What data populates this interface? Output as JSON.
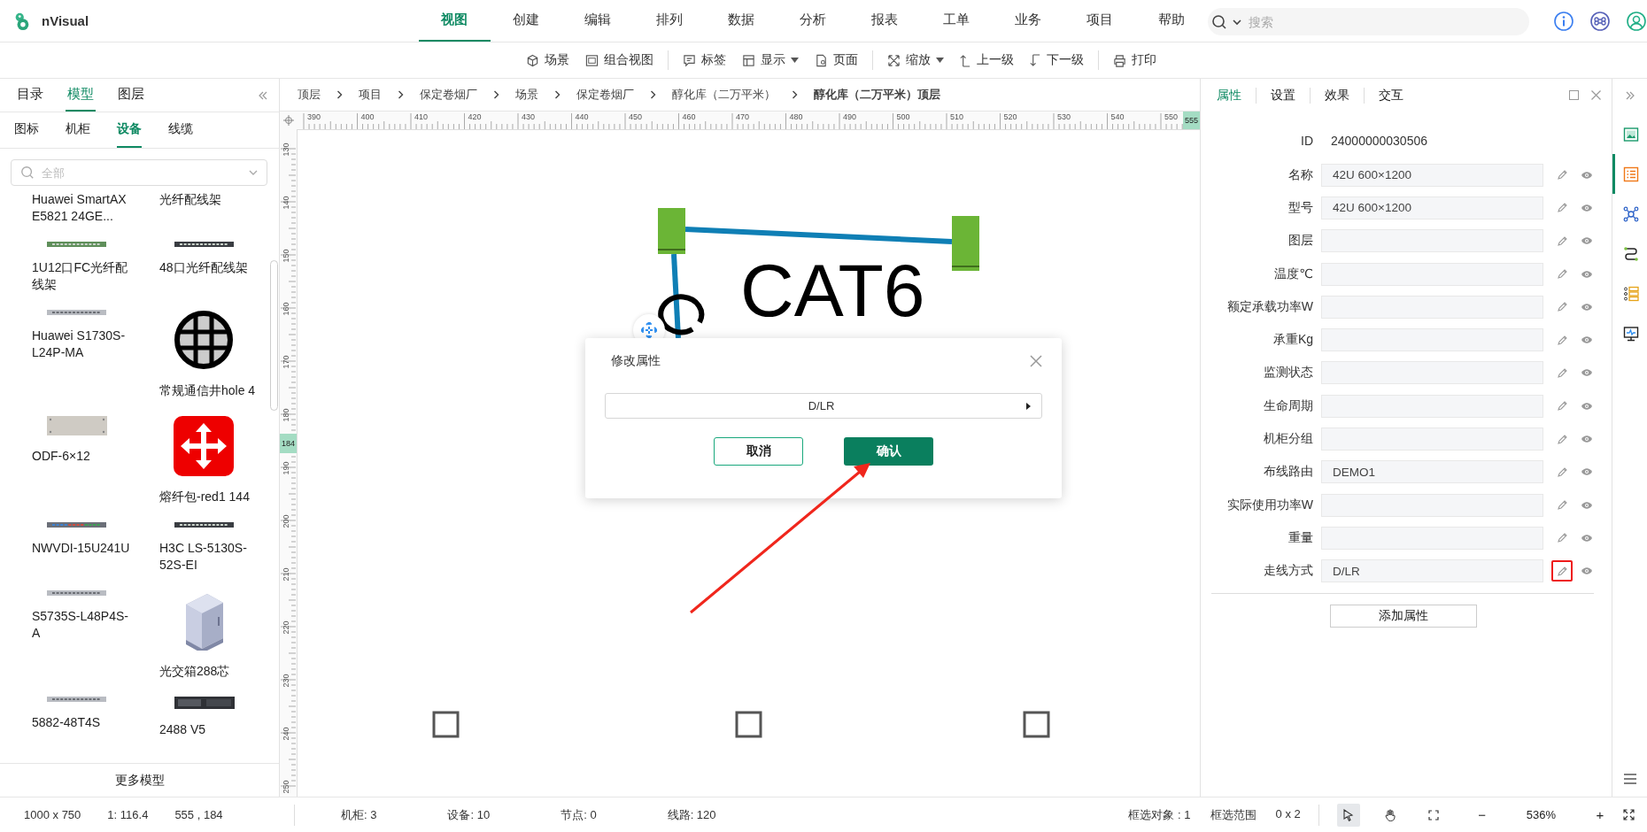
{
  "app": {
    "name": "nVisual"
  },
  "menu": [
    {
      "label": "视图",
      "selected": true
    },
    {
      "label": "创建",
      "selected": false
    },
    {
      "label": "编辑",
      "selected": false
    },
    {
      "label": "排列",
      "selected": false
    },
    {
      "label": "数据",
      "selected": false
    },
    {
      "label": "分析",
      "selected": false
    },
    {
      "label": "报表",
      "selected": false
    },
    {
      "label": "工单",
      "selected": false
    },
    {
      "label": "业务",
      "selected": false
    },
    {
      "label": "项目",
      "selected": false
    },
    {
      "label": "帮助",
      "selected": false
    }
  ],
  "search": {
    "placeholder": "搜索"
  },
  "toolbar": [
    {
      "kind": "scene",
      "label": "场景",
      "dropdown": false
    },
    {
      "kind": "combined",
      "label": "组合视图",
      "dropdown": false
    },
    {
      "kind": "divider"
    },
    {
      "kind": "label",
      "label": "标签",
      "dropdown": false
    },
    {
      "kind": "display",
      "label": "显示",
      "dropdown": true
    },
    {
      "kind": "page",
      "label": "页面",
      "dropdown": false
    },
    {
      "kind": "divider"
    },
    {
      "kind": "zoom",
      "label": "缩放",
      "dropdown": true
    },
    {
      "kind": "up",
      "label": "上一级",
      "dropdown": false
    },
    {
      "kind": "down",
      "label": "下一级",
      "dropdown": false
    },
    {
      "kind": "divider"
    },
    {
      "kind": "print",
      "label": "打印",
      "dropdown": false
    }
  ],
  "left_panel": {
    "tabs": [
      {
        "label": "目录",
        "selected": false
      },
      {
        "label": "模型",
        "selected": true
      },
      {
        "label": "图层",
        "selected": false
      }
    ],
    "subtabs": [
      {
        "label": "图标",
        "selected": false
      },
      {
        "label": "机柜",
        "selected": false
      },
      {
        "label": "设备",
        "selected": true
      },
      {
        "label": "线缆",
        "selected": false
      }
    ],
    "search": {
      "placeholder": "全部"
    },
    "items": [
      {
        "name": "Huawei SmartAX E5821 24GE..."
      },
      {
        "name": "光纤配线架"
      },
      {
        "name": "1U12口FC光纤配线架",
        "kind": "patch"
      },
      {
        "name": "48口光纤配线架",
        "kind": "dark"
      },
      {
        "name": "Huawei S1730S-L24P-MA",
        "kind": "switch"
      },
      {
        "name": "常规通信井hole 4",
        "kind": "manhole"
      },
      {
        "name": "ODF-6×12",
        "kind": "odf"
      },
      {
        "name": "熔纤包-red1 144",
        "kind": "splice"
      },
      {
        "name": "NWVDI-15U241U",
        "kind": "ports"
      },
      {
        "name": "H3C LS-5130S-52S-EI",
        "kind": "dark"
      },
      {
        "name": "S5735S-L48P4S-A",
        "kind": "switch"
      },
      {
        "name": "光交箱288芯",
        "kind": "cabinet"
      },
      {
        "name": "5882-48T4S",
        "kind": "switch"
      },
      {
        "name": "2488 V5",
        "kind": "server"
      }
    ],
    "more_button": "更多模型"
  },
  "breadcrumb": [
    "顶层",
    "项目",
    "保定卷烟厂",
    "场景",
    "保定卷烟厂",
    "醇化库（二万平米）",
    "醇化库（二万平米）顶层"
  ],
  "canvas": {
    "top_ruler": {
      "labels": [
        "390",
        "400",
        "410",
        "420",
        "430",
        "440",
        "450",
        "460",
        "470",
        "480",
        "490",
        "500",
        "510",
        "520",
        "530",
        "540",
        "550"
      ],
      "marker": "555"
    },
    "left_ruler": {
      "labels": [
        "130",
        "140",
        "150",
        "160",
        "170",
        "180",
        "190",
        "200",
        "210",
        "220",
        "230",
        "240",
        "250"
      ],
      "marker": "184"
    },
    "label": "CAT6"
  },
  "dialog": {
    "title": "修改属性",
    "select": {
      "value": "D/LR"
    },
    "buttons": [
      {
        "label": "取消",
        "kind": "secondary"
      },
      {
        "label": "确认",
        "kind": "primary"
      }
    ]
  },
  "properties": {
    "tabs": [
      {
        "label": "属性",
        "selected": true
      },
      {
        "label": "设置",
        "selected": false
      },
      {
        "label": "效果",
        "selected": false
      },
      {
        "label": "交互",
        "selected": false
      }
    ],
    "id": {
      "label": "ID",
      "value": "24000000030506"
    },
    "rows": [
      {
        "label": "名称",
        "value": "42U 600×1200",
        "highlighted": false
      },
      {
        "label": "型号",
        "value": "42U 600×1200",
        "highlighted": false
      },
      {
        "label": "图层",
        "highlighted": false
      },
      {
        "label": "温度℃",
        "highlighted": false
      },
      {
        "label": "额定承载功率W",
        "highlighted": false
      },
      {
        "label": "承重Kg",
        "highlighted": false
      },
      {
        "label": "监测状态",
        "highlighted": false
      },
      {
        "label": "生命周期",
        "highlighted": false
      },
      {
        "label": "机柜分组",
        "highlighted": false
      },
      {
        "label": "布线路由",
        "value": "DEMO1",
        "highlighted": false
      },
      {
        "label": "实际使用功率W",
        "highlighted": false
      },
      {
        "label": "重量",
        "highlighted": false
      },
      {
        "label": "走线方式",
        "value": "D/LR",
        "highlighted": true
      }
    ],
    "add_button": "添加属性"
  },
  "rail": [
    {
      "kind": "image",
      "selected": false
    },
    {
      "kind": "list",
      "selected": true
    },
    {
      "kind": "network",
      "selected": false
    },
    {
      "kind": "route",
      "selected": false
    },
    {
      "kind": "rack",
      "selected": false
    },
    {
      "kind": "monitor",
      "selected": false
    }
  ],
  "status_bar": {
    "info": [
      "1000 x 750",
      "1: 116.4",
      "555 , 184"
    ],
    "counts": [
      "机柜: 3",
      "设备: 10",
      "节点: 0",
      "线路: 120"
    ],
    "selection": [
      "框选对象 : 1",
      "框选范围",
      "0 x 2"
    ],
    "tools": [
      {
        "kind": "pointer",
        "selected": true
      },
      {
        "kind": "hand",
        "selected": false
      },
      {
        "kind": "fit",
        "selected": false
      }
    ],
    "zoom_out": "−",
    "zoom": "536%",
    "zoom_in": "+"
  }
}
